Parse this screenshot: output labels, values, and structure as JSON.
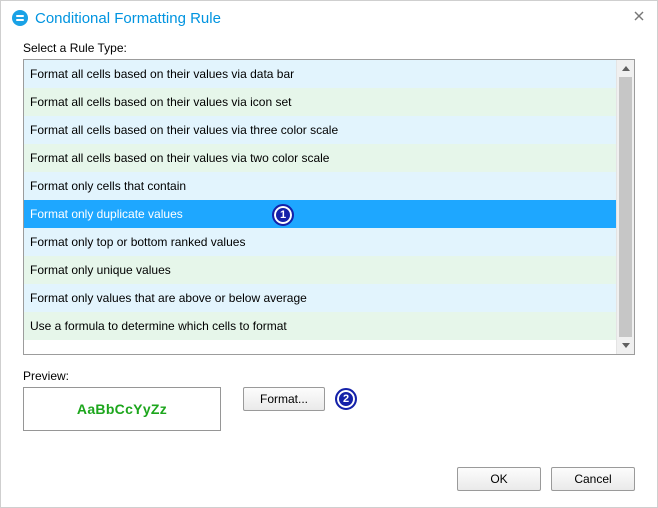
{
  "window": {
    "title": "Conditional Formatting Rule"
  },
  "ruleType": {
    "label": "Select a Rule Type:",
    "items": [
      "Format all cells based on their values via data bar",
      "Format all cells based on their values via icon set",
      "Format all cells based on their values via three color scale",
      "Format all cells based on their values via two color scale",
      "Format only cells that contain",
      "Format only duplicate values",
      "Format only top or bottom ranked values",
      "Format only unique values",
      "Format only values that are above or below average",
      "Use a formula to determine which cells to format"
    ],
    "selectedIndex": 5
  },
  "preview": {
    "label": "Preview:",
    "sample": "AaBbCcYyZz",
    "sampleColor": "#1ca61c"
  },
  "buttons": {
    "format": "Format...",
    "ok": "OK",
    "cancel": "Cancel"
  },
  "markers": {
    "one": "1",
    "two": "2"
  }
}
